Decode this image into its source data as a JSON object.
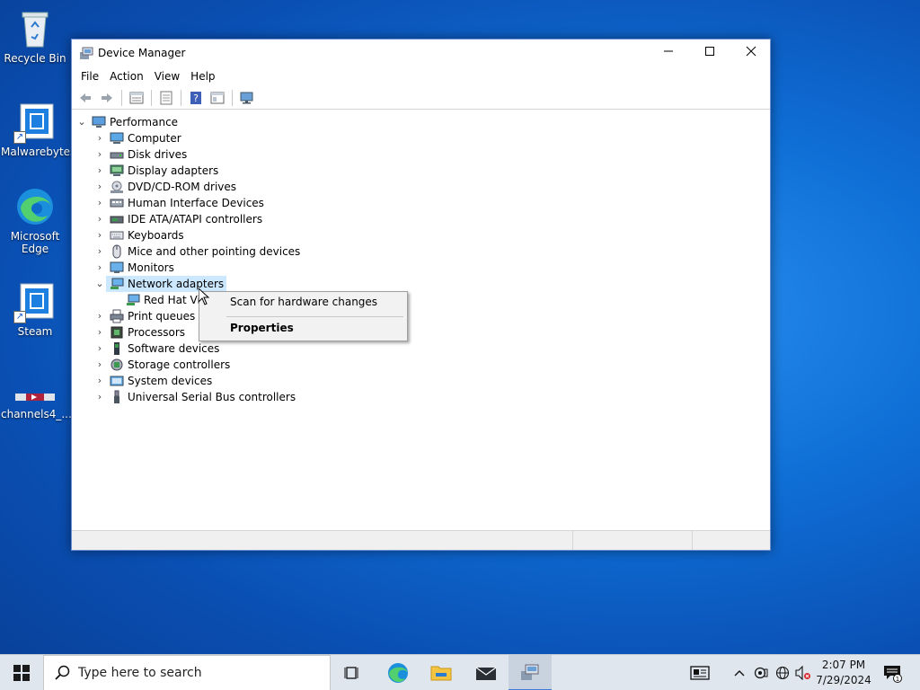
{
  "desktop": {
    "icons": [
      {
        "label": "Recycle Bin",
        "icon": "recycle-bin-icon"
      },
      {
        "label": "Malwarebytes",
        "icon": "malwarebytes-shortcut-icon"
      },
      {
        "label": "Microsoft Edge",
        "icon": "edge-icon"
      },
      {
        "label": "Steam",
        "icon": "steam-shortcut-icon"
      },
      {
        "label": "channels4_...",
        "icon": "image-file-icon"
      }
    ]
  },
  "window": {
    "title": "Device Manager",
    "menu": [
      "File",
      "Action",
      "View",
      "Help"
    ],
    "toolbar": [
      "back-arrow-icon",
      "forward-arrow-icon",
      "properties-icon",
      "update-driver-icon",
      "help-icon",
      "view-icon",
      "monitor-scan-icon"
    ],
    "tree": {
      "root": "Performance",
      "categories": [
        {
          "label": "Computer",
          "icon": "computer-icon"
        },
        {
          "label": "Disk drives",
          "icon": "disk-drive-icon"
        },
        {
          "label": "Display adapters",
          "icon": "display-adapter-icon"
        },
        {
          "label": "DVD/CD-ROM drives",
          "icon": "dvd-drive-icon"
        },
        {
          "label": "Human Interface Devices",
          "icon": "hid-icon"
        },
        {
          "label": "IDE ATA/ATAPI controllers",
          "icon": "ide-controller-icon"
        },
        {
          "label": "Keyboards",
          "icon": "keyboard-icon"
        },
        {
          "label": "Mice and other pointing devices",
          "icon": "mouse-icon"
        },
        {
          "label": "Monitors",
          "icon": "monitor-icon"
        },
        {
          "label": "Network adapters",
          "icon": "network-adapter-icon",
          "expanded": true,
          "selected": true
        },
        {
          "label": "Print queues",
          "icon": "printer-icon"
        },
        {
          "label": "Processors",
          "icon": "processor-icon"
        },
        {
          "label": "Software devices",
          "icon": "software-device-icon"
        },
        {
          "label": "Storage controllers",
          "icon": "storage-controller-icon"
        },
        {
          "label": "System devices",
          "icon": "system-device-icon"
        },
        {
          "label": "Universal Serial Bus controllers",
          "icon": "usb-icon"
        }
      ],
      "network_child": "Red Hat Vir"
    }
  },
  "context_menu": {
    "items": [
      "Scan for hardware changes",
      "Properties"
    ]
  },
  "taskbar": {
    "search_placeholder": "Type here to search",
    "time": "2:07 PM",
    "date": "7/29/2024",
    "notification_count": "1"
  },
  "colors": {
    "selection": "#cce8ff",
    "accent": "#0078d7"
  }
}
